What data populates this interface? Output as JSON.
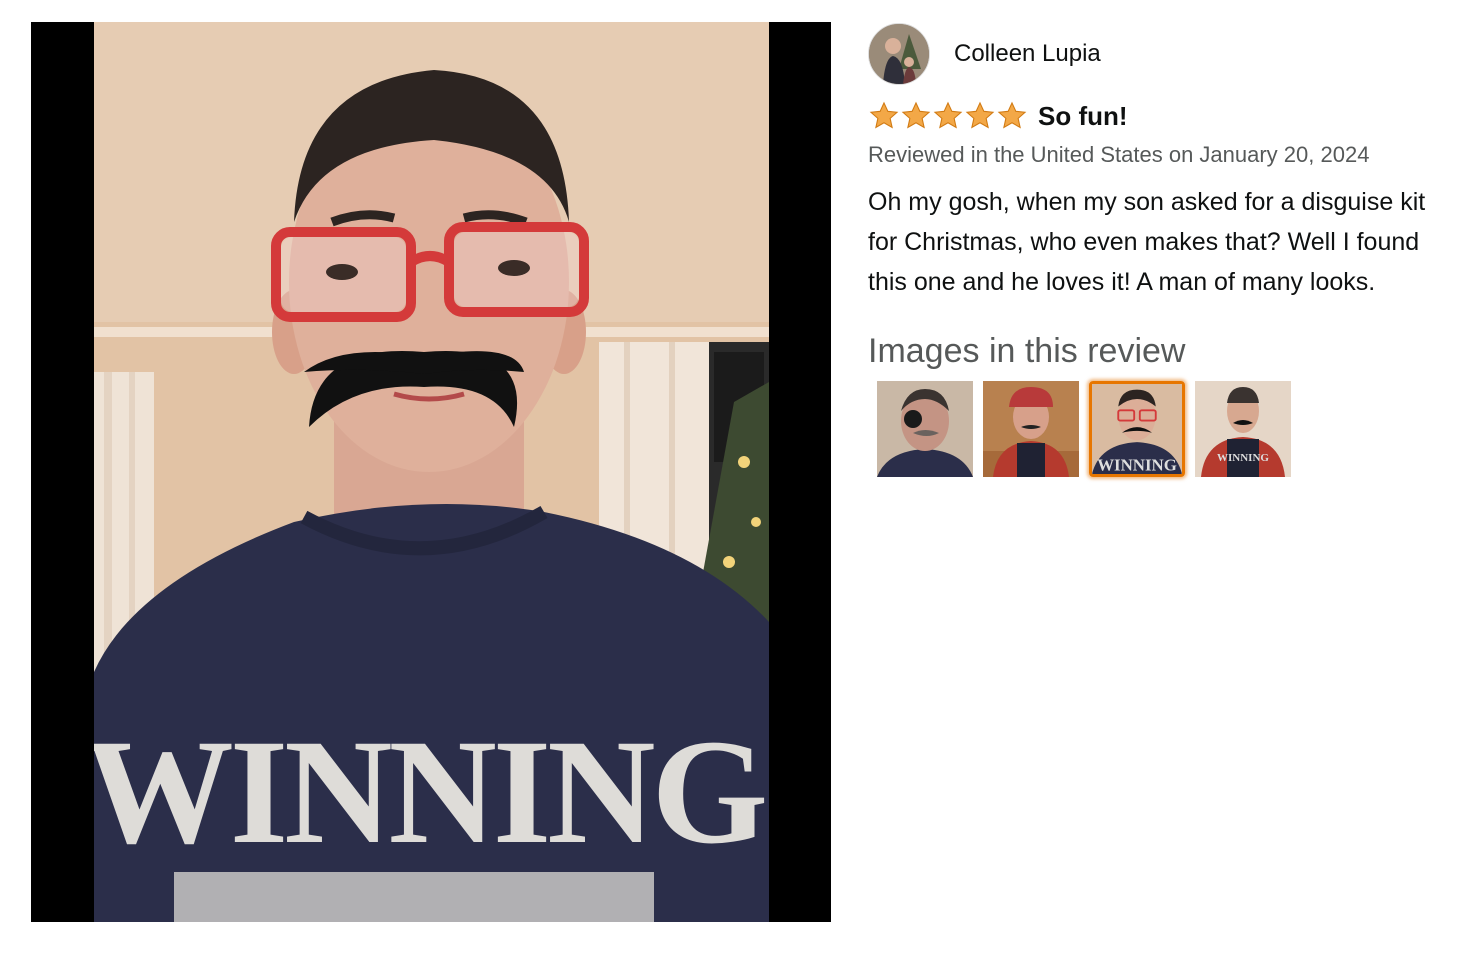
{
  "viewer": {
    "shirt_text": "WINNING"
  },
  "review": {
    "reviewer_name": "Colleen Lupia",
    "rating": 5,
    "rating_max": 5,
    "title": "So fun!",
    "meta": "Reviewed in the United States on January 20, 2024",
    "body": "Oh my gosh, when my son asked for a disguise kit for Christmas, who even makes that? Well I found this one and he loves it! A man of many looks.",
    "images_heading": "Images in this review",
    "selected_thumbnail": 3,
    "thumbnails": [
      {
        "subject": "eyepatch-disguise"
      },
      {
        "subject": "plaid-shirt-hat-disguise"
      },
      {
        "subject": "glasses-mustache-disguise"
      },
      {
        "subject": "plaid-shirt-mustache-disguise"
      }
    ]
  },
  "colors": {
    "star": "#f3a847",
    "star_outline": "#d17a12",
    "selected_border": "#e77600",
    "meta_text": "#565959",
    "glasses": "#d43a3a",
    "shirt": "#2b2e4a"
  }
}
